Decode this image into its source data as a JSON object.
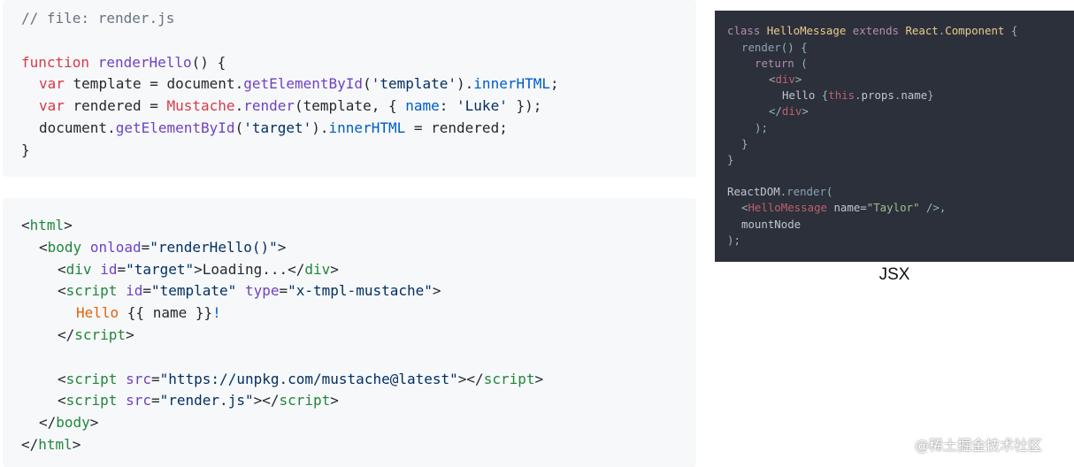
{
  "js_block": {
    "comment": "// file: render.js",
    "l1": [
      "function",
      " ",
      "renderHello",
      "() {"
    ],
    "l2": [
      "var",
      " template = document.",
      "getElementById",
      "(",
      "'template'",
      ").",
      "innerHTML",
      ";"
    ],
    "l3": [
      "var",
      " rendered = ",
      "Mustache",
      ".",
      "render",
      "(template, { ",
      "name",
      ": ",
      "'Luke'",
      " });"
    ],
    "l4": [
      "document.",
      "getElementById",
      "(",
      "'target'",
      ").",
      "innerHTML",
      " = rendered;"
    ],
    "l5": "}"
  },
  "html_block": {
    "l1": [
      "<",
      "html",
      ">"
    ],
    "l2": [
      "<",
      "body",
      " ",
      "onload",
      "=",
      "\"renderHello()\"",
      ">"
    ],
    "l3": [
      "<",
      "div",
      " ",
      "id",
      "=",
      "\"target\"",
      ">Loading...</",
      "div",
      ">"
    ],
    "l4": [
      "<",
      "script",
      " ",
      "id",
      "=",
      "\"template\"",
      " ",
      "type",
      "=",
      "\"x-tmpl-mustache\"",
      ">"
    ],
    "l5": [
      "Hello ",
      "{{ name }}",
      "!"
    ],
    "l6": [
      "</",
      "script",
      ">"
    ],
    "l8": [
      "<",
      "script",
      " ",
      "src",
      "=",
      "\"https://unpkg.com/mustache@latest\"",
      "></",
      "script",
      ">"
    ],
    "l9": [
      "<",
      "script",
      " ",
      "src",
      "=",
      "\"render.js\"",
      "></",
      "script",
      ">"
    ],
    "l10": [
      "</",
      "body",
      ">"
    ],
    "l11": [
      "</",
      "html",
      ">"
    ]
  },
  "jsx_block": {
    "l1": [
      "class",
      " ",
      "HelloMessage",
      " ",
      "extends",
      " ",
      "React",
      ".",
      "Component",
      " {"
    ],
    "l2": [
      "render",
      "() {"
    ],
    "l3": [
      "return",
      " ("
    ],
    "l4": [
      "<",
      "div",
      ">"
    ],
    "l5": [
      "Hello ",
      "{",
      "this",
      ".",
      "props",
      ".",
      "name",
      "}"
    ],
    "l6": [
      "</",
      "div",
      ">"
    ],
    "l7": ");",
    "l8": "}",
    "l9": "}",
    "l11": [
      "ReactDOM",
      ".",
      "render",
      "("
    ],
    "l12": [
      "<",
      "HelloMessage",
      " name=",
      "\"Taylor\"",
      " />",
      ","
    ],
    "l13": "mountNode",
    "l14": ");"
  },
  "caption": "JSX",
  "watermark": "@稀土掘金技术社区",
  "colors": {
    "code_bg_light": "#f6f8fa",
    "code_bg_dark": "#2b303b",
    "keyword": "#d73a49",
    "function": "#6f42c1",
    "property": "#005cc5",
    "string": "#032f62",
    "tag": "#22863a"
  }
}
